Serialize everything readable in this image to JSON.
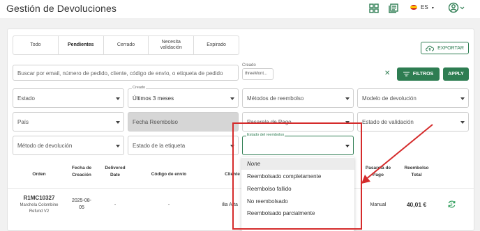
{
  "header": {
    "title": "Gestión de Devoluciones",
    "language": "ES"
  },
  "tabs": [
    "Todo",
    "Pendientes",
    "Cerrado",
    "Necesita validación",
    "Expirado"
  ],
  "export_label": "EXPORTAR",
  "search": {
    "placeholder": "Buscar por email, número de pedido, cliente, código de envío, o etiqueta de pedido"
  },
  "created": {
    "label": "Creado",
    "value": "threeMont..."
  },
  "filtros_label": "FILTROS",
  "apply_label": "APPLY",
  "filters": {
    "estado": "Estado",
    "creado_label": "Creado",
    "creado_value": "Últimos 3 meses",
    "metodos_reembolso": "Métodos de reembolso",
    "modelo_devolucion": "Modelo de devolución",
    "pais": "País",
    "fecha_reembolso": "Fecha Reembolso",
    "pasarela_pago": "Pasarela de Pago",
    "estado_validacion": "Estado de validación",
    "metodo_devolucion": "Método de devolución",
    "estado_etiqueta": "Estado de la etiqueta",
    "estado_reembolso_label": "Estado del reembolso"
  },
  "table": {
    "headers": {
      "orden": "Orden",
      "fecha_creacion": "Fecha de Creación",
      "delivered_date": "Delivered Date",
      "codigo_envio": "Código de envío",
      "cliente": "Cliente",
      "pasarela_pago": "Pasarela de Pago",
      "reembolso_total": "Reembolso Total"
    },
    "row": {
      "order_id": "R1MC10327",
      "order_sub": "Marchela Colombine Refund V2",
      "fecha": "2025-08-05",
      "delivered": "-",
      "codigo": "-",
      "cliente": "ilia Arta",
      "pasarela": "Manual",
      "total": "40,01 €"
    }
  },
  "dropdown_options": [
    "None",
    "Reembolsado completamente",
    "Reembolso fallido",
    "No reembolsado",
    "Reembolsado parcialmente"
  ],
  "colors": {
    "accent": "#2e7d52",
    "annotation": "#d52b2b"
  }
}
